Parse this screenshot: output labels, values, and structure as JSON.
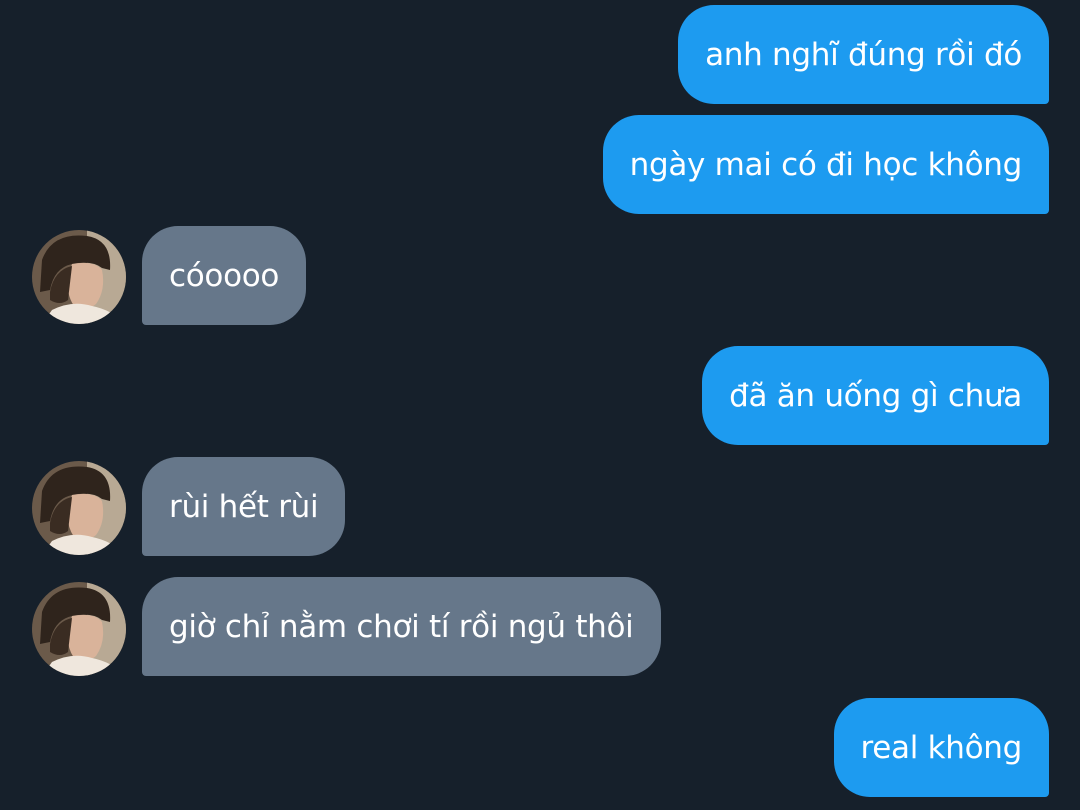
{
  "messages": [
    {
      "side": "sent",
      "text": "anh nghĩ đúng rồi đó"
    },
    {
      "side": "sent",
      "text": "ngày mai có đi học không"
    },
    {
      "side": "received",
      "text": "cóoooo"
    },
    {
      "side": "sent",
      "text": "đã ăn uống gì chưa"
    },
    {
      "side": "received",
      "text": "rùi hết rùi"
    },
    {
      "side": "received",
      "text": "giờ chỉ nằm chơi tí rồi ngủ thôi"
    },
    {
      "side": "sent",
      "text": "real không"
    }
  ],
  "colors": {
    "background": "#16202b",
    "sent_bubble": "#1d9bf0",
    "received_bubble": "#66778a",
    "text": "#ffffff"
  },
  "icons": {
    "avatar": "profile-photo-avatar"
  }
}
